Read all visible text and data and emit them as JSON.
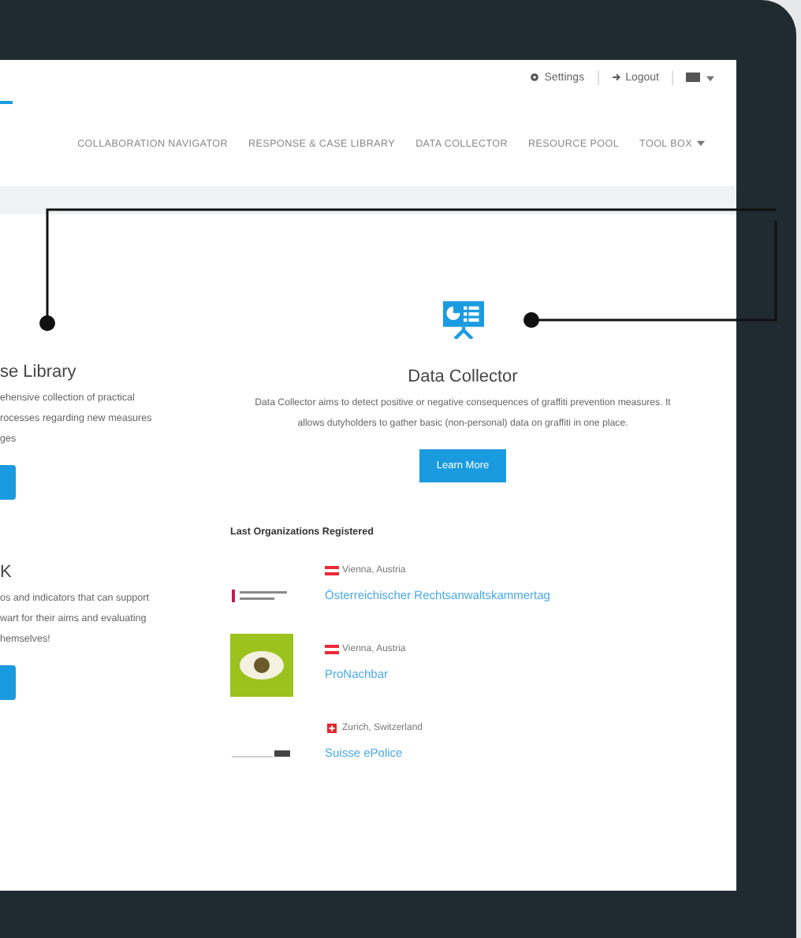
{
  "header": {
    "settings": "Settings",
    "logout": "Logout"
  },
  "nav": [
    {
      "label": "COLLABORATION NAVIGATOR",
      "has_menu": false
    },
    {
      "label": "RESPONSE & CASE LIBRARY",
      "has_menu": false
    },
    {
      "label": "DATA COLLECTOR",
      "has_menu": false
    },
    {
      "label": "RESOURCE POOL",
      "has_menu": false
    },
    {
      "label": "TOOL BOX",
      "has_menu": true
    }
  ],
  "left_cards": [
    {
      "title": "se Library",
      "lines": [
        "ehensive collection of practical",
        "rocesses regarding new measures",
        "ges"
      ]
    },
    {
      "title": "K",
      "lines": [
        "os and indicators that can support",
        "wart for their aims and evaluating",
        "hemselves!"
      ]
    }
  ],
  "feature": {
    "title": "Data Collector",
    "text": "Data Collector aims to detect positive or negative consequences of graffiti prevention measures. It allows dutyholders to gather basic (non-personal) data on graffiti in one place.",
    "button": "Learn More"
  },
  "organizations": {
    "heading": "Last Organizations Registered",
    "items": [
      {
        "location": "Vienna, Austria",
        "flag": {
          "kind": "austria"
        },
        "logo": {
          "kind": "wordmark"
        },
        "name": "Österreichischer Rechtsanwaltskammertag"
      },
      {
        "location": "Vienna, Austria",
        "flag": {
          "kind": "austria"
        },
        "logo": {
          "kind": "badge"
        },
        "name": "ProNachbar"
      },
      {
        "location": "Zurich, Switzerland",
        "flag": {
          "kind": "switzerland"
        },
        "logo": {
          "kind": "signature"
        },
        "name": "Suisse ePolice"
      }
    ]
  }
}
